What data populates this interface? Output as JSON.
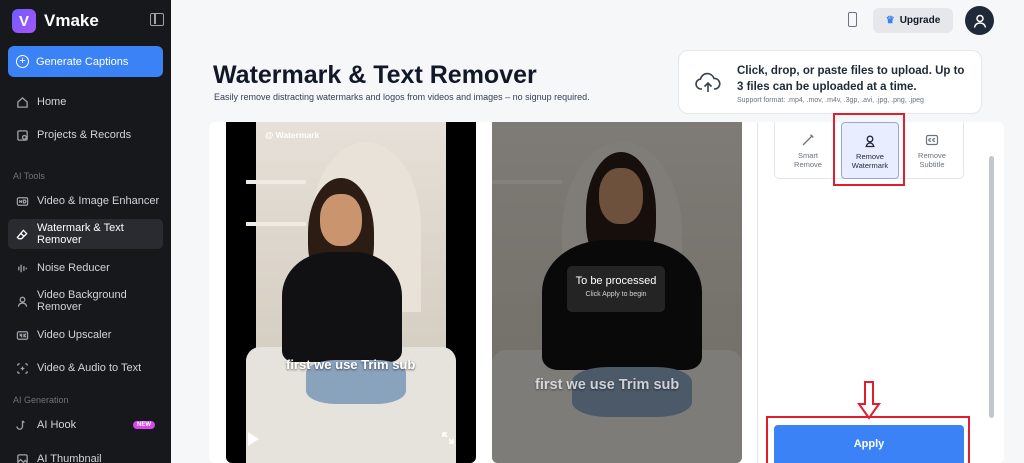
{
  "app": {
    "name": "Vmake",
    "logo_letter": "V"
  },
  "sidebar": {
    "generate_button": "Generate Captions",
    "items_top": [
      {
        "label": "Home",
        "icon": "home-icon"
      },
      {
        "label": "Projects & Records",
        "icon": "projects-icon"
      }
    ],
    "section_ai_tools": "AI Tools",
    "ai_tools": [
      {
        "label": "Video & Image Enhancer",
        "icon": "hd-icon"
      },
      {
        "label": "Watermark & Text Remover",
        "icon": "eraser-icon",
        "active": true
      },
      {
        "label": "Noise Reducer",
        "icon": "noise-icon"
      },
      {
        "label": "Video Background Remover",
        "icon": "person-bg-icon"
      },
      {
        "label": "Video Upscaler",
        "icon": "4k-icon"
      },
      {
        "label": "Video & Audio to Text",
        "icon": "transcribe-icon"
      }
    ],
    "section_ai_generation": "AI Generation",
    "ai_generation": [
      {
        "label": "AI Hook",
        "icon": "hook-icon",
        "badge": "NEW"
      },
      {
        "label": "AI Thumbnail",
        "icon": "thumbnail-icon"
      }
    ]
  },
  "topbar": {
    "upgrade_label": "Upgrade"
  },
  "page": {
    "title": "Watermark & Text Remover",
    "subtitle": "Easily remove distracting watermarks and logos from videos and images – no signup required."
  },
  "upload": {
    "main_text": "Click, drop, or paste files to upload. Up to 3 files can be uploaded at a time.",
    "formats": "Support format: .mp4, .mov, .m4v, .3gp, .avi, .jpg, .png, .jpeg"
  },
  "preview": {
    "watermark_text": "@ Watermark",
    "caption_text": "first we use Trim sub",
    "processing_title": "To be processed",
    "processing_sub": "Click Apply to begin"
  },
  "tools": [
    {
      "label_1": "Smart",
      "label_2": "Remove",
      "icon": "magic-wand-icon",
      "selected": false
    },
    {
      "label_1": "Remove",
      "label_2": "Watermark",
      "icon": "remove-watermark-icon",
      "selected": true
    },
    {
      "label_1": "Remove",
      "label_2": "Subtitle",
      "icon": "cc-icon",
      "selected": false
    }
  ],
  "apply_label": "Apply",
  "colors": {
    "accent": "#3b82f6",
    "sidebar_bg": "#17181c",
    "annotation_red": "#e11d2e"
  }
}
